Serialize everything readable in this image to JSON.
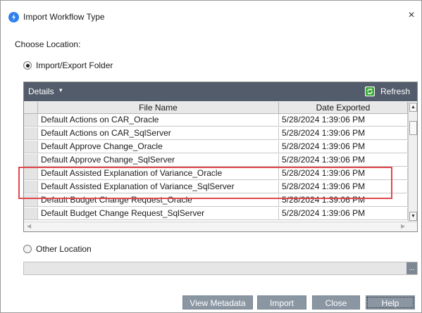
{
  "window": {
    "title": "Import Workflow Type",
    "close_glyph": "×"
  },
  "choose_location_label": "Choose Location:",
  "options": {
    "import_export_folder": "Import/Export Folder",
    "other_location": "Other Location",
    "selected": "import_export_folder"
  },
  "toolbar": {
    "details_label": "Details",
    "details_caret": "▾",
    "refresh_label": "Refresh"
  },
  "table": {
    "columns": [
      "File Name",
      "Date Exported"
    ],
    "rows": [
      {
        "file_name": "Default Actions on CAR_Oracle",
        "date_exported": "5/28/2024 1:39:06 PM"
      },
      {
        "file_name": "Default Actions on CAR_SqlServer",
        "date_exported": "5/28/2024 1:39:06 PM"
      },
      {
        "file_name": "Default Approve Change_Oracle",
        "date_exported": "5/28/2024 1:39:06 PM"
      },
      {
        "file_name": "Default Approve Change_SqlServer",
        "date_exported": "5/28/2024 1:39:06 PM"
      },
      {
        "file_name": "Default Assisted Explanation of Variance_Oracle",
        "date_exported": "5/28/2024 1:39:06 PM"
      },
      {
        "file_name": "Default Assisted Explanation of Variance_SqlServer",
        "date_exported": "5/28/2024 1:39:06 PM"
      },
      {
        "file_name": "Default Budget Change Request_Oracle",
        "date_exported": "5/28/2024 1:39:06 PM"
      },
      {
        "file_name": "Default Budget Change Request_SqlServer",
        "date_exported": "5/28/2024 1:39:06 PM"
      }
    ]
  },
  "other_location_input": {
    "value": "",
    "browse_label": "..."
  },
  "buttons": {
    "view_metadata": "View Metadata",
    "import": "Import",
    "close": "Close",
    "help": "Help"
  },
  "colors": {
    "header_bar": "#525c6b",
    "button": "#8b96a3",
    "highlight": "#e0474c",
    "app_icon": "#2f80ed",
    "refresh_icon": "#3aa83a"
  },
  "icons": {
    "app": "app-logo-icon",
    "close": "close-icon",
    "refresh": "refresh-icon",
    "dropdown": "chevron-down-icon"
  }
}
